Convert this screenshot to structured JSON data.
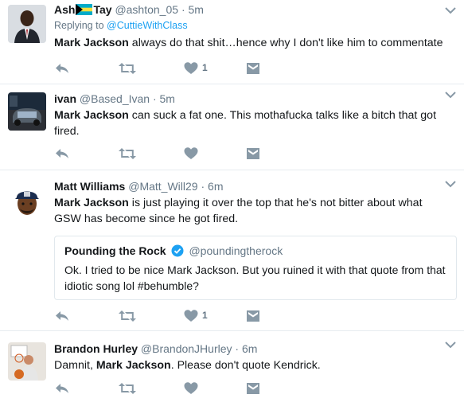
{
  "tweets": [
    {
      "name_part1": "Ash",
      "name_part2": "Tay",
      "handle": "@ashton_05",
      "separator": "·",
      "time": "5m",
      "reply_prefix": "Replying to",
      "reply_to": "@CuttieWithClass",
      "mention": "Mark Jackson",
      "text": " always do that shit…hence why I don't like him to commentate",
      "like_count": "1"
    },
    {
      "name": "ivan",
      "handle": "@Based_Ivan",
      "separator": "·",
      "time": "5m",
      "mention": "Mark Jackson",
      "text": " can suck a fat one. This mothafucka talks like a bitch that got fired."
    },
    {
      "name": "Matt Williams",
      "handle": "@Matt_Will29",
      "separator": "·",
      "time": "6m",
      "mention": "Mark Jackson",
      "text": " is just playing it over the top that he's not bitter about what GSW has become since he got fired.",
      "like_count": "1",
      "quote": {
        "name": "Pounding the Rock",
        "handle": "@poundingtherock",
        "text": "Ok. I tried to be nice Mark Jackson. But you ruined it with that quote from that idiotic song lol #behumble?"
      }
    },
    {
      "name": "Brandon Hurley",
      "handle": "@BrandonJHurley",
      "separator": "·",
      "time": "6m",
      "text_before": "Damnit, ",
      "mention": "Mark Jackson",
      "text_after": ". Please don't quote Kendrick."
    }
  ],
  "colors": {
    "icon": "#8899a6",
    "link": "#1da1f2",
    "verified": "#1da1f2",
    "divider": "#e6ecf0"
  }
}
